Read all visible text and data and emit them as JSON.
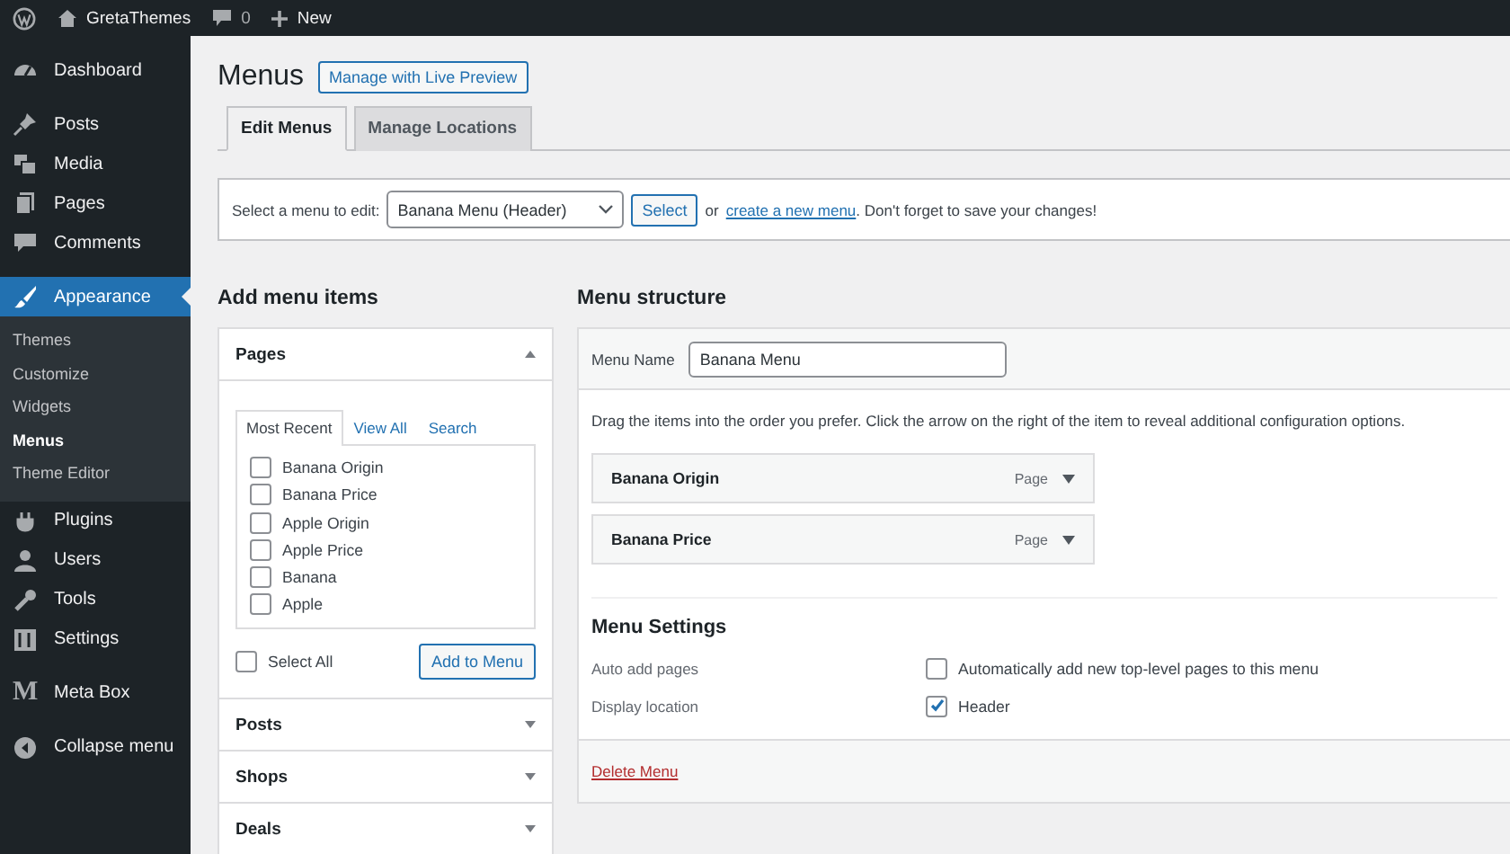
{
  "admin_bar": {
    "site": "GretaThemes",
    "comments": "0",
    "new": "New"
  },
  "sidebar": {
    "items": [
      {
        "label": "Dashboard",
        "selected": false
      },
      {
        "label": "Posts",
        "selected": false
      },
      {
        "label": "Media",
        "selected": false
      },
      {
        "label": "Pages",
        "selected": false
      },
      {
        "label": "Comments",
        "selected": false
      },
      {
        "label": "Appearance",
        "selected": true,
        "children": [
          {
            "label": "Themes",
            "selected": false
          },
          {
            "label": "Customize",
            "selected": false
          },
          {
            "label": "Widgets",
            "selected": false
          },
          {
            "label": "Menus",
            "selected": true
          },
          {
            "label": "Theme Editor",
            "selected": false
          }
        ]
      },
      {
        "label": "Plugins",
        "selected": false
      },
      {
        "label": "Users",
        "selected": false
      },
      {
        "label": "Tools",
        "selected": false
      },
      {
        "label": "Settings",
        "selected": false
      },
      {
        "label": "Meta Box",
        "selected": false,
        "glyph": "M"
      },
      {
        "label": "Collapse menu",
        "selected": false
      }
    ]
  },
  "page": {
    "title": "Menus",
    "live_preview_button": "Manage with Live Preview",
    "tabs": [
      {
        "label": "Edit Menus",
        "selected": true
      },
      {
        "label": "Manage Locations",
        "selected": false
      }
    ]
  },
  "menu_select": {
    "label": "Select a menu to edit:",
    "value": "Banana Menu (Header)",
    "button": "Select",
    "text_before": "or",
    "link": "create a new menu",
    "text_after": ". Don't forget to save your changes!"
  },
  "add_menu_items": {
    "heading": "Add menu items",
    "sections": [
      {
        "title": "Pages",
        "expanded": true,
        "tabs": [
          {
            "label": "Most Recent",
            "selected": true
          },
          {
            "label": "View All",
            "selected": false
          },
          {
            "label": "Search",
            "selected": false
          }
        ],
        "items": [
          {
            "label": "Banana Origin",
            "checked": false
          },
          {
            "label": "Banana Price",
            "checked": false
          },
          {
            "label": "Apple Origin",
            "checked": false
          },
          {
            "label": "Apple Price",
            "checked": false
          },
          {
            "label": "Banana",
            "checked": false
          },
          {
            "label": "Apple",
            "checked": false
          }
        ],
        "select_all": {
          "label": "Select All",
          "checked": false
        },
        "button": "Add to Menu"
      },
      {
        "title": "Posts",
        "expanded": false
      },
      {
        "title": "Shops",
        "expanded": false
      },
      {
        "title": "Deals",
        "expanded": false
      }
    ]
  },
  "menu_structure": {
    "heading": "Menu structure",
    "name_label": "Menu Name",
    "name_value": "Banana Menu",
    "instructions": "Drag the items into the order you prefer. Click the arrow on the right of the item to reveal additional configuration options.",
    "items": [
      {
        "title": "Banana Origin",
        "type": "Page"
      },
      {
        "title": "Banana Price",
        "type": "Page"
      }
    ],
    "settings_heading": "Menu Settings",
    "settings": [
      {
        "label": "Auto add pages",
        "option": "Automatically add new top-level pages to this menu",
        "checked": false
      },
      {
        "label": "Display location",
        "option": "Header",
        "checked": true
      }
    ],
    "delete_link": "Delete Menu"
  }
}
